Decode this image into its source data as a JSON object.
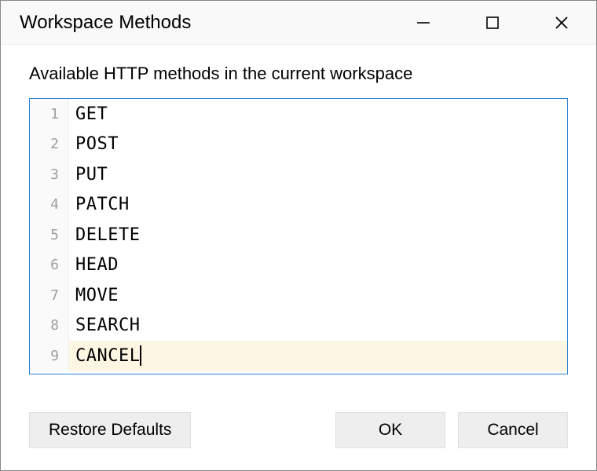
{
  "titlebar": {
    "title": "Workspace Methods"
  },
  "content": {
    "description": "Available HTTP methods in the current workspace"
  },
  "editor": {
    "lines": [
      {
        "n": "1",
        "text": "GET"
      },
      {
        "n": "2",
        "text": "POST"
      },
      {
        "n": "3",
        "text": "PUT"
      },
      {
        "n": "4",
        "text": "PATCH"
      },
      {
        "n": "5",
        "text": "DELETE"
      },
      {
        "n": "6",
        "text": "HEAD"
      },
      {
        "n": "7",
        "text": "MOVE"
      },
      {
        "n": "8",
        "text": "SEARCH"
      },
      {
        "n": "9",
        "text": "CANCEL"
      }
    ],
    "cursor_line_index": 8
  },
  "buttons": {
    "restore": "Restore Defaults",
    "ok": "OK",
    "cancel": "Cancel"
  }
}
